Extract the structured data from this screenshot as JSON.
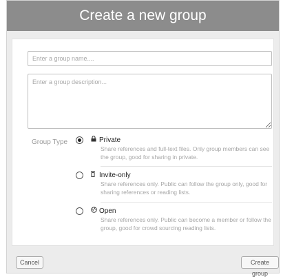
{
  "dialog": {
    "title": "Create a new group"
  },
  "form": {
    "name_placeholder": "Enter a group name....",
    "description_placeholder": "Enter a group description...",
    "group_type_label": "Group Type",
    "options": [
      {
        "title": "Private",
        "icon": "lock-icon",
        "selected": true,
        "description": "Share references and full-text files. Only group members can see the group, good for sharing in private."
      },
      {
        "title": "Invite-only",
        "icon": "invite-icon",
        "selected": false,
        "description": "Share references only. Public can follow the group only, good for sharing references or reading lists."
      },
      {
        "title": "Open",
        "icon": "globe-icon",
        "selected": false,
        "description": "Share references only. Public can become a member or follow the group, good for crowd sourcing reading lists."
      }
    ]
  },
  "footer": {
    "cancel_label": "Cancel",
    "create_label": "Create group"
  }
}
